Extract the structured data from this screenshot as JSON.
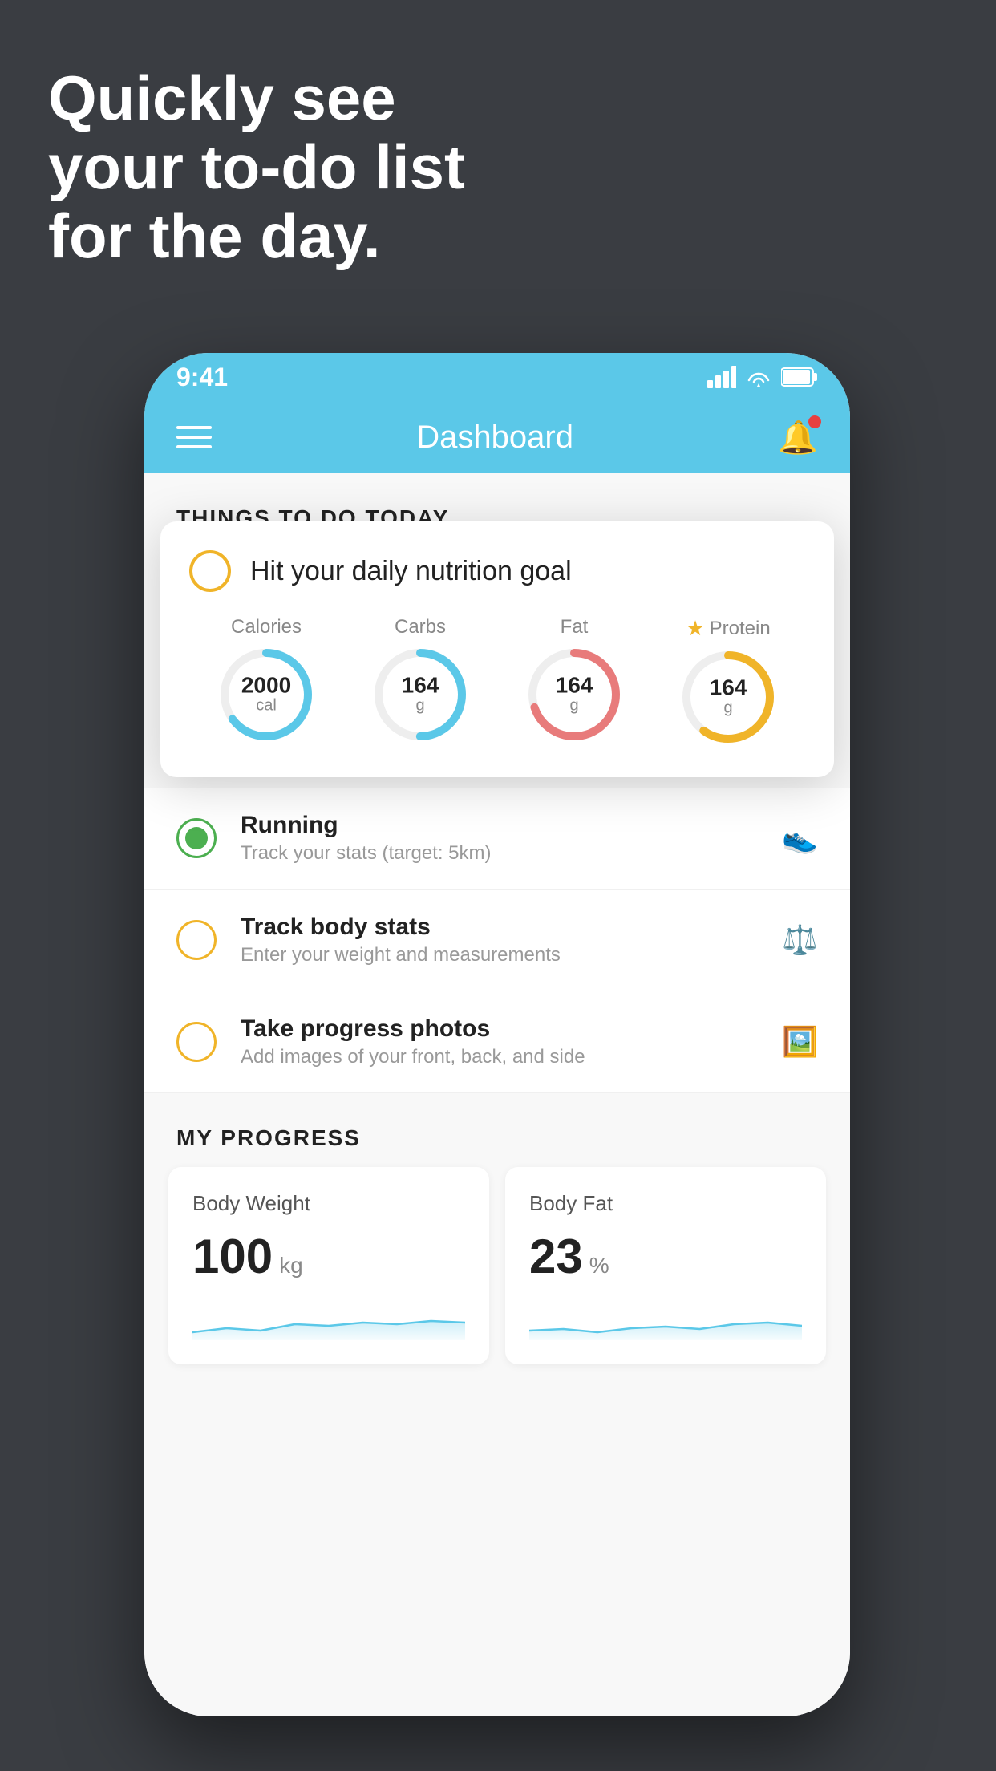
{
  "hero": {
    "line1": "Quickly see",
    "line2": "your to-do list",
    "line3": "for the day."
  },
  "status_bar": {
    "time": "9:41",
    "signal": "▋▋▋▋",
    "wifi": "wifi",
    "battery": "battery"
  },
  "nav": {
    "title": "Dashboard"
  },
  "section_header": "THINGS TO DO TODAY",
  "nutrition_card": {
    "title": "Hit your daily nutrition goal",
    "macros": [
      {
        "label": "Calories",
        "value": "2000",
        "unit": "cal",
        "color": "#5bc8e8",
        "progress": 0.65,
        "starred": false
      },
      {
        "label": "Carbs",
        "value": "164",
        "unit": "g",
        "color": "#5bc8e8",
        "progress": 0.5,
        "starred": false
      },
      {
        "label": "Fat",
        "value": "164",
        "unit": "g",
        "color": "#e87b7b",
        "progress": 0.7,
        "starred": false
      },
      {
        "label": "Protein",
        "value": "164",
        "unit": "g",
        "color": "#f0b429",
        "progress": 0.6,
        "starred": true
      }
    ]
  },
  "todo_items": [
    {
      "id": "running",
      "status": "green",
      "main": "Running",
      "sub": "Track your stats (target: 5km)",
      "icon": "👟"
    },
    {
      "id": "body-stats",
      "status": "yellow",
      "main": "Track body stats",
      "sub": "Enter your weight and measurements",
      "icon": "⚖️"
    },
    {
      "id": "progress-photos",
      "status": "yellow",
      "main": "Take progress photos",
      "sub": "Add images of your front, back, and side",
      "icon": "🖼️"
    }
  ],
  "progress": {
    "section_title": "MY PROGRESS",
    "cards": [
      {
        "title": "Body Weight",
        "value": "100",
        "unit": "kg"
      },
      {
        "title": "Body Fat",
        "value": "23",
        "unit": "%"
      }
    ]
  }
}
